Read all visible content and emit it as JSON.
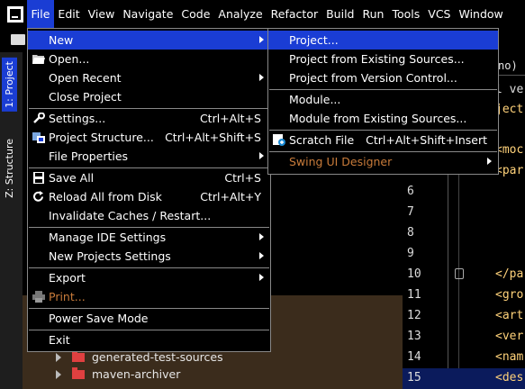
{
  "menubar": {
    "items": [
      "File",
      "Edit",
      "View",
      "Navigate",
      "Code",
      "Analyze",
      "Refactor",
      "Build",
      "Run",
      "Tools",
      "VCS",
      "Window"
    ],
    "active_index": 0
  },
  "left_strip": {
    "tabs": [
      "1: Project",
      "Z: Structure"
    ]
  },
  "file_menu": {
    "items": [
      {
        "label": "New",
        "shortcut": "",
        "submenu": true
      },
      {
        "label": "Open...",
        "shortcut": "",
        "submenu": false,
        "icon": "folder-open-icon"
      },
      {
        "label": "Open Recent",
        "shortcut": "",
        "submenu": true
      },
      {
        "label": "Close Project",
        "shortcut": "",
        "submenu": false
      },
      {
        "label": "Settings...",
        "shortcut": "Ctrl+Alt+S",
        "submenu": false,
        "icon": "wrench-icon"
      },
      {
        "label": "Project Structure...",
        "shortcut": "Ctrl+Alt+Shift+S",
        "submenu": false,
        "icon": "project-structure-icon"
      },
      {
        "label": "File Properties",
        "shortcut": "",
        "submenu": true
      },
      {
        "label": "Save All",
        "shortcut": "Ctrl+S",
        "submenu": false,
        "icon": "save-icon"
      },
      {
        "label": "Reload All from Disk",
        "shortcut": "Ctrl+Alt+Y",
        "submenu": false,
        "icon": "reload-icon"
      },
      {
        "label": "Invalidate Caches / Restart...",
        "shortcut": "",
        "submenu": false
      },
      {
        "label": "Manage IDE Settings",
        "shortcut": "",
        "submenu": true
      },
      {
        "label": "New Projects Settings",
        "shortcut": "",
        "submenu": true
      },
      {
        "label": "Export",
        "shortcut": "",
        "submenu": true
      },
      {
        "label": "Print...",
        "shortcut": "",
        "submenu": false,
        "icon": "print-icon",
        "disabled": true
      },
      {
        "label": "Power Save Mode",
        "shortcut": "",
        "submenu": false
      },
      {
        "label": "Exit",
        "shortcut": "",
        "submenu": false
      }
    ]
  },
  "new_submenu": {
    "items": [
      {
        "label": "Project...",
        "shortcut": ""
      },
      {
        "label": "Project from Existing Sources...",
        "shortcut": ""
      },
      {
        "label": "Project from Version Control...",
        "shortcut": ""
      },
      {
        "label": "Module...",
        "shortcut": ""
      },
      {
        "label": "Module from Existing Sources...",
        "shortcut": ""
      },
      {
        "label": "Scratch File",
        "shortcut": "Ctrl+Alt+Shift+Insert",
        "icon": "scratch-file-icon"
      },
      {
        "label": "Swing UI Designer",
        "shortcut": "",
        "submenu": true,
        "disabled": true
      }
    ]
  },
  "project_tree": {
    "rows": [
      "generated-test-sources",
      "maven-archiver"
    ]
  },
  "editor": {
    "tab_fragment": "no) ×",
    "line_numbers": [
      "6",
      "7",
      "8",
      "9",
      "10",
      "11",
      "12",
      "13",
      "14",
      "15"
    ],
    "code_top": [
      "l ve",
      "ject"
    ],
    "code_mid": [
      "<moc",
      "<par"
    ],
    "code_lines": [
      "",
      "",
      "",
      "",
      "</pa",
      "<gro",
      "<art",
      "<ver",
      "<nam",
      "<des"
    ]
  },
  "colors": {
    "accent": "#1a3dd4",
    "disabled_orange": "#c87b3a"
  }
}
